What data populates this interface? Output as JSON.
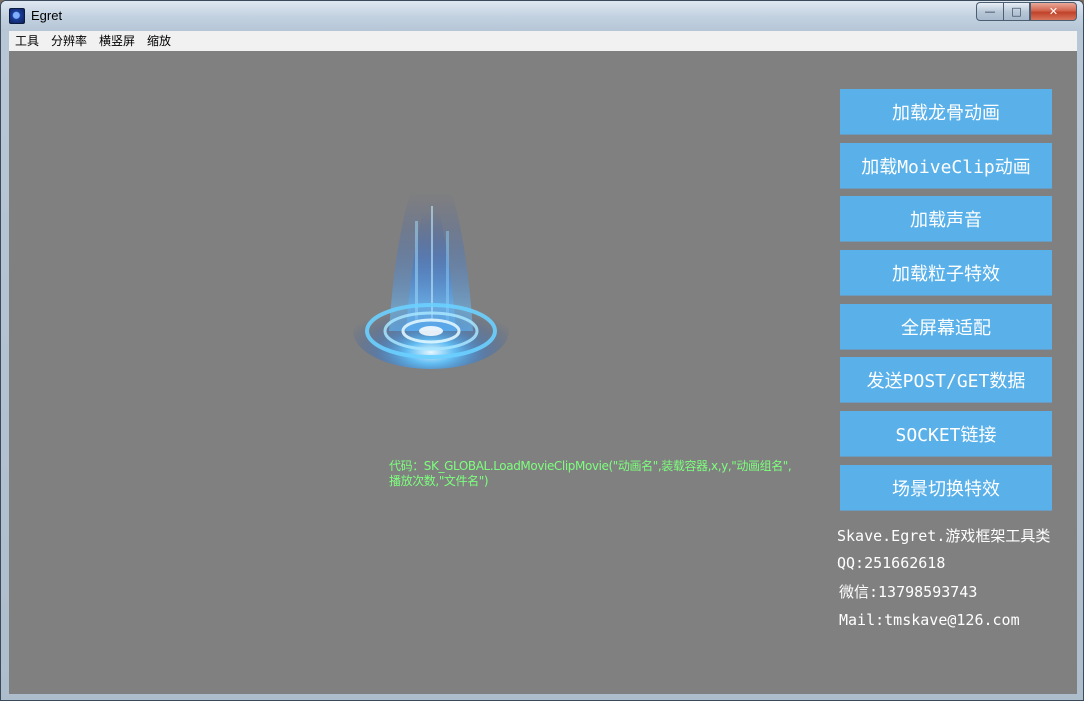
{
  "window": {
    "title": "Egret",
    "controls": {
      "minimize": "—",
      "maximize": "□",
      "close": "✕"
    }
  },
  "menu": [
    "工具",
    "分辨率",
    "横竖屏",
    "缩放"
  ],
  "code_hint": "代码：SK_GLOBAL.LoadMovieClipMovie(\"动画名\",装载容器,x,y,\"动画组名\",播放次数,\"文件名\")",
  "buttons": [
    "加载龙骨动画",
    "加载MoiveClip动画",
    "加载声音",
    "加载粒子特效",
    "全屏幕适配",
    "发送POST/GET数据",
    "SOCKET链接",
    "场景切换特效"
  ],
  "info": {
    "title": "Skave.Egret.游戏框架工具类",
    "qq": "QQ:251662618",
    "wechat": "微信:13798593743",
    "mail": "Mail:tmskave@126.com"
  },
  "colors": {
    "button_bg": "#5ab1ea",
    "canvas_bg": "#808080",
    "code_text": "#7dff7d"
  }
}
